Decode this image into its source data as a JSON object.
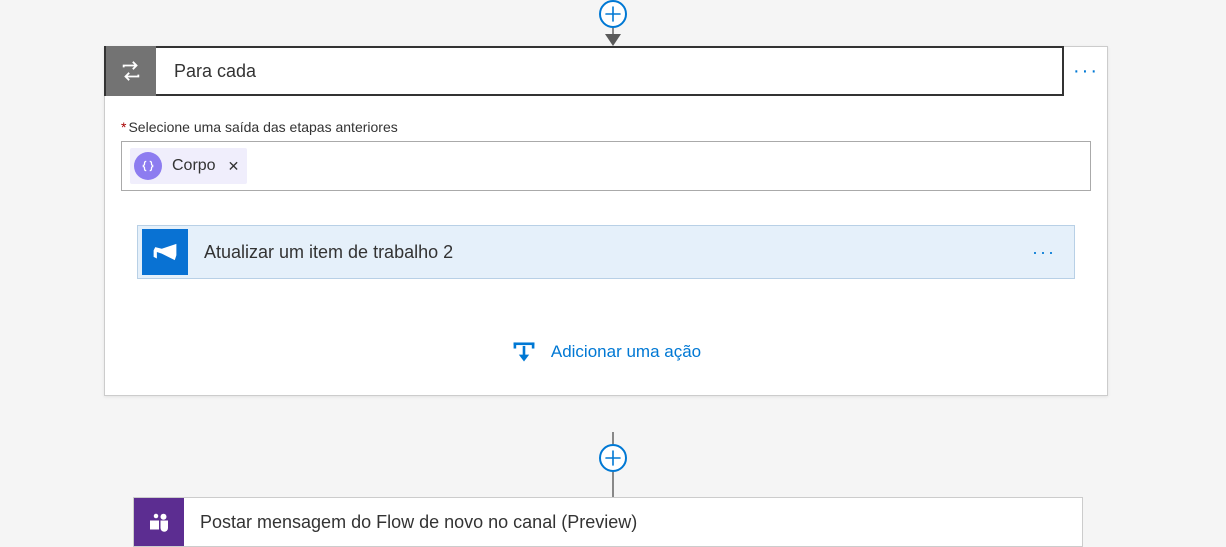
{
  "loopCard": {
    "title": "Para cada",
    "output_field_label": "Selecione uma saída das etapas anteriores",
    "token_label": "Corpo",
    "nested_action_title": "Atualizar um item de trabalho 2",
    "add_action_label": "Adicionar uma ação"
  },
  "bottomCard": {
    "title": "Postar mensagem do Flow de novo no canal (Preview)"
  }
}
